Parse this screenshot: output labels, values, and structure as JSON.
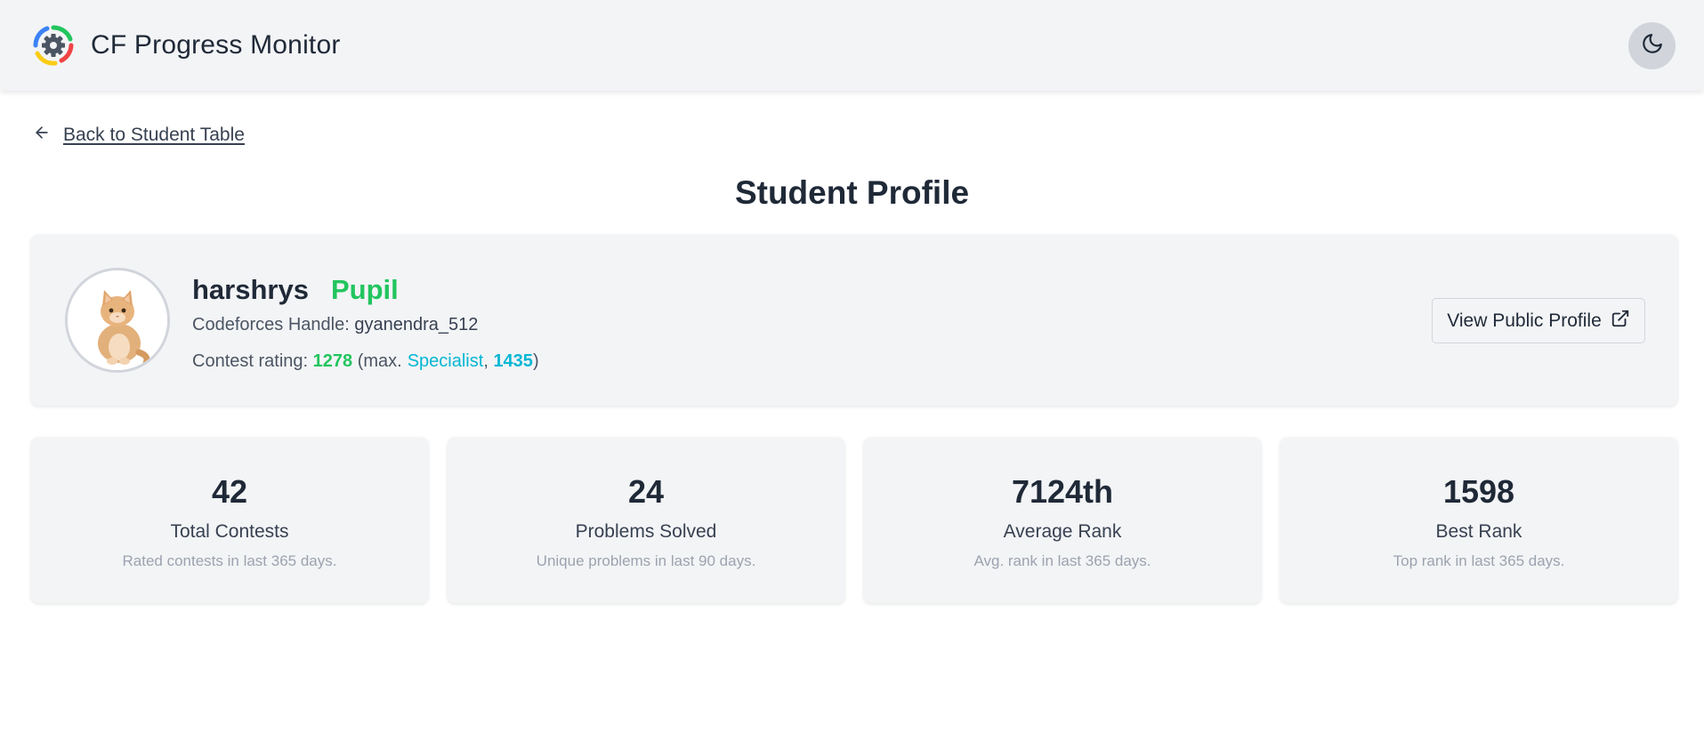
{
  "header": {
    "app_title": "CF Progress Monitor",
    "logo_icon": "gear-icon",
    "theme_toggle_icon": "moon-icon"
  },
  "nav": {
    "back_label": "Back to Student Table",
    "back_icon": "arrow-left-icon"
  },
  "page": {
    "title": "Student Profile"
  },
  "profile": {
    "username": "harshrys",
    "rank": "Pupil",
    "handle_label": "Codeforces Handle:",
    "handle": "gyanendra_512",
    "rating_label": "Contest rating:",
    "rating": "1278",
    "max_prefix": "(max.",
    "max_rank": "Specialist",
    "max_separator": ",",
    "max_rating": "1435",
    "max_suffix": ")",
    "view_button_label": "View Public Profile",
    "view_button_icon": "external-link-icon",
    "rank_color": "#22c55e",
    "max_rank_color": "#06b6d4"
  },
  "stats": [
    {
      "value": "42",
      "label": "Total Contests",
      "desc": "Rated contests in last 365 days."
    },
    {
      "value": "24",
      "label": "Problems Solved",
      "desc": "Unique problems in last 90 days."
    },
    {
      "value": "7124th",
      "label": "Average Rank",
      "desc": "Avg. rank in last 365 days."
    },
    {
      "value": "1598",
      "label": "Best Rank",
      "desc": "Top rank in last 365 days."
    }
  ]
}
